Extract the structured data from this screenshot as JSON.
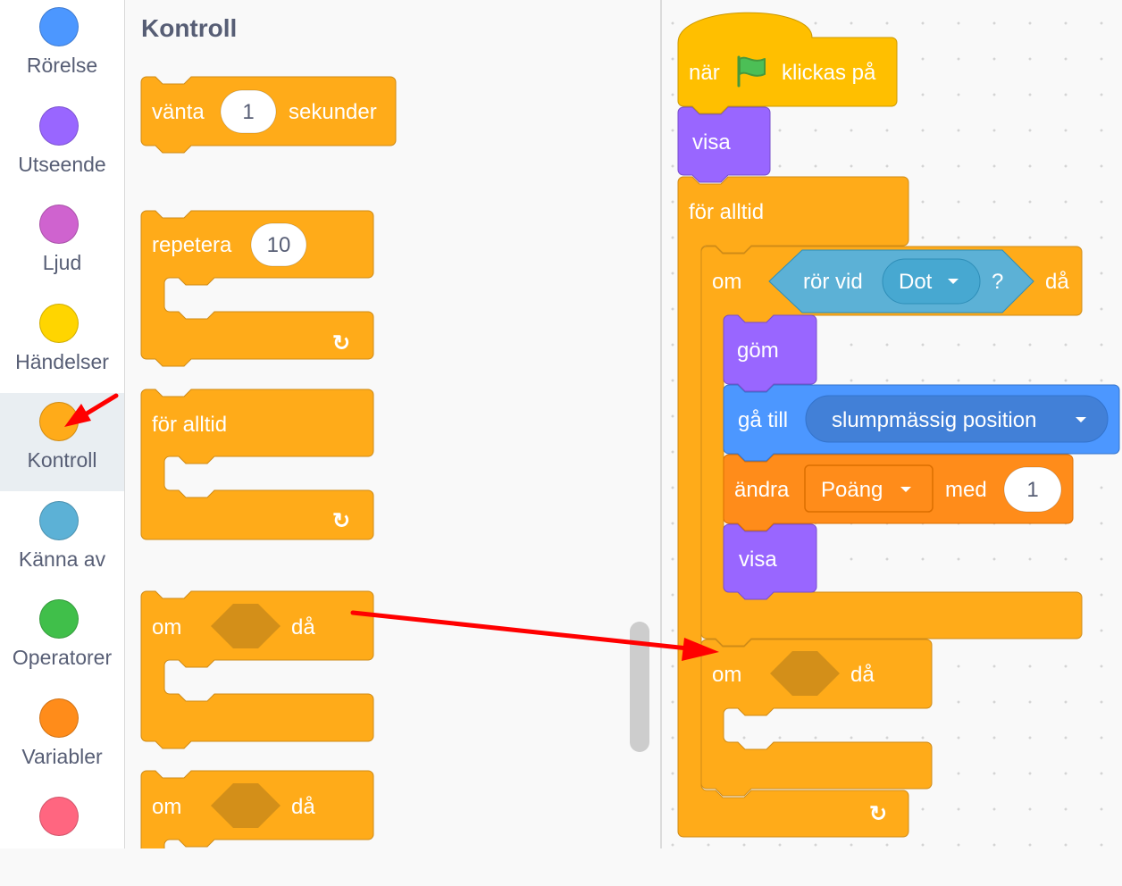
{
  "categories": [
    {
      "label": "Rörelse",
      "color": "#4c97ff",
      "icon": "motion-category-icon"
    },
    {
      "label": "Utseende",
      "color": "#9966ff",
      "icon": "looks-category-icon"
    },
    {
      "label": "Ljud",
      "color": "#cf63cf",
      "icon": "sound-category-icon"
    },
    {
      "label": "Händelser",
      "color": "#ffd500",
      "icon": "events-category-icon"
    },
    {
      "label": "Kontroll",
      "color": "#ffab19",
      "icon": "control-category-icon",
      "selected": true
    },
    {
      "label": "Känna av",
      "color": "#5cb1d6",
      "icon": "sensing-category-icon"
    },
    {
      "label": "Operatorer",
      "color": "#40bf4a",
      "icon": "operators-category-icon"
    },
    {
      "label": "Variabler",
      "color": "#ff8c1a",
      "icon": "variables-category-icon"
    },
    {
      "label": "",
      "color": "#ff6680",
      "icon": "my-blocks-category-icon"
    }
  ],
  "palette": {
    "title": "Kontroll",
    "wait": {
      "before": "vänta",
      "value": "1",
      "after": "sekunder"
    },
    "repeat": {
      "label": "repetera",
      "value": "10"
    },
    "forever": {
      "label": "för alltid"
    },
    "if1": {
      "before": "om",
      "after": "då"
    },
    "if2": {
      "before": "om",
      "after": "då"
    }
  },
  "script": {
    "hat": {
      "before": "när",
      "after": "klickas på",
      "icon": "green-flag-icon"
    },
    "show1": "visa",
    "forever": "för alltid",
    "if1": {
      "before": "om",
      "after": "då"
    },
    "touching": {
      "label": "rör vid",
      "value": "Dot",
      "suffix": "?"
    },
    "hide": "göm",
    "goto": {
      "label": "gå till",
      "value": "slumpmässig position"
    },
    "change": {
      "label": "ändra",
      "variable": "Poäng",
      "mid": "med",
      "value": "1"
    },
    "show2": "visa",
    "if2": {
      "before": "om",
      "after": "då"
    }
  },
  "icons": {
    "loop_arrow": "↻",
    "dropdown_arrow": "▼"
  },
  "colors": {
    "control": "#ffab19",
    "control_border": "#cf8b17",
    "control_slot": "#d38f19",
    "events": "#ffbf00",
    "looks": "#9966ff",
    "motion": "#4c97ff",
    "sensing": "#5cb1d6",
    "variables": "#ff8c1a",
    "annotation_arrow": "#ff0000"
  }
}
